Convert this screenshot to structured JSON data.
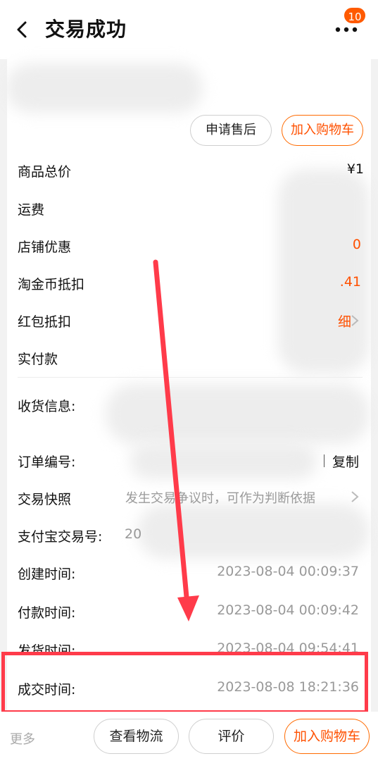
{
  "header": {
    "title": "交易成功",
    "badge_count": "10"
  },
  "actions": {
    "after_sale": "申请售后",
    "add_to_cart": "加入购物车"
  },
  "price_rows": [
    {
      "label": "商品总价",
      "value": "¥1"
    },
    {
      "label": "运费",
      "value": ""
    },
    {
      "label": "店铺优惠",
      "value": "0"
    },
    {
      "label": "淘金币抵扣",
      "value": ".41"
    },
    {
      "label": "红包抵扣",
      "value": "细"
    },
    {
      "label": "实付款",
      "value": ""
    }
  ],
  "order_info": {
    "receiver_label": "收货信息:",
    "order_no_label": "订单编号:",
    "copy_label": "复制",
    "snapshot_label": "交易快照",
    "snapshot_hint": "发生交易争议时，可作为判断依据",
    "alipay_label": "支付宝交易号:",
    "alipay_value": "20",
    "created_label": "创建时间:",
    "created_value": "2023-08-04 00:09:37",
    "paid_label": "付款时间:",
    "paid_value": "2023-08-04 00:09:42",
    "shipped_label": "发货时间:",
    "shipped_value": "2023-08-04 09:54:41",
    "completed_label": "成交时间:",
    "completed_value": "2023-08-08 18:21:36"
  },
  "bottom_bar": {
    "more": "更多",
    "logistics": "查看物流",
    "review": "评价",
    "add_to_cart": "加入购物车"
  },
  "colors": {
    "accent": "#ff5000",
    "annotation": "#ff3b4a",
    "badge": "#ff5a00"
  }
}
